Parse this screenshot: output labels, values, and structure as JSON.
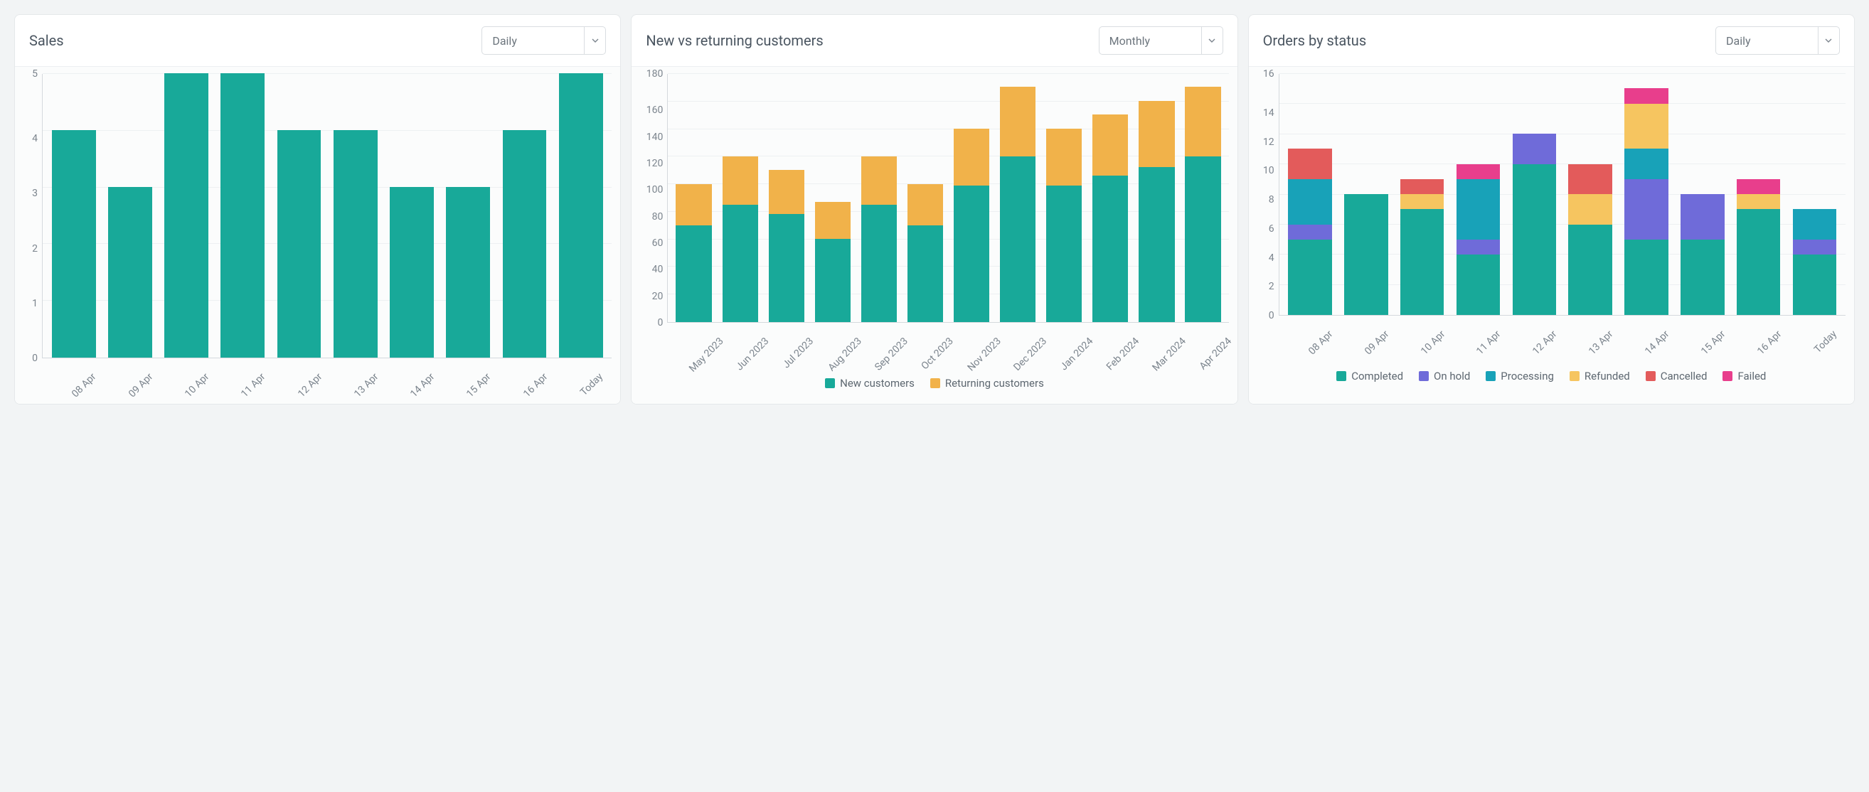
{
  "colors": {
    "teal": "#18a999",
    "orange": "#f1b24a",
    "purple": "#6f6bd9",
    "cyan": "#18a2b8",
    "amber": "#f6c560",
    "red": "#e35b5b",
    "pink": "#e83e8c"
  },
  "cards": {
    "sales": {
      "title": "Sales",
      "select": "Daily"
    },
    "customers": {
      "title": "New vs returning customers",
      "select": "Monthly"
    },
    "orders": {
      "title": "Orders by status",
      "select": "Daily"
    }
  },
  "legends": {
    "customers": {
      "new": "New customers",
      "returning": "Returning customers"
    },
    "orders": {
      "completed": "Completed",
      "onhold": "On hold",
      "processing": "Processing",
      "refunded": "Refunded",
      "cancelled": "Cancelled",
      "failed": "Failed"
    }
  },
  "chart_data": [
    {
      "id": "sales",
      "type": "bar",
      "title": "Sales",
      "xlabel": "",
      "ylabel": "",
      "ylim": [
        0,
        5
      ],
      "yticks": [
        0,
        1,
        2,
        3,
        4,
        5
      ],
      "categories": [
        "08 Apr",
        "09 Apr",
        "10 Apr",
        "11 Apr",
        "12 Apr",
        "13 Apr",
        "14 Apr",
        "15 Apr",
        "16 Apr",
        "Today"
      ],
      "values": [
        4,
        3,
        5,
        5,
        4,
        4,
        3,
        3,
        4,
        5
      ],
      "color": "#18a999"
    },
    {
      "id": "customers",
      "type": "bar-stacked",
      "title": "New vs returning customers",
      "xlabel": "",
      "ylabel": "",
      "ylim": [
        0,
        180
      ],
      "yticks": [
        0,
        20,
        40,
        60,
        80,
        100,
        120,
        140,
        160,
        180
      ],
      "categories": [
        "May 2023",
        "Jun 2023",
        "Jul 2023",
        "Aug 2023",
        "Sep 2023",
        "Oct 2023",
        "Nov 2023",
        "Dec 2023",
        "Jan 2024",
        "Feb 2024",
        "Mar 2024",
        "Apr 2024"
      ],
      "series": [
        {
          "name": "New customers",
          "color": "#18a999",
          "values": [
            70,
            85,
            78,
            60,
            85,
            70,
            99,
            120,
            99,
            106,
            112,
            120
          ]
        },
        {
          "name": "Returning customers",
          "color": "#f1b24a",
          "values": [
            30,
            35,
            32,
            27,
            35,
            30,
            41,
            50,
            41,
            44,
            48,
            50
          ]
        }
      ],
      "legend_position": "bottom"
    },
    {
      "id": "orders",
      "type": "bar-stacked",
      "title": "Orders by status",
      "xlabel": "",
      "ylabel": "",
      "ylim": [
        0,
        16
      ],
      "yticks": [
        0,
        2,
        4,
        6,
        8,
        10,
        12,
        14,
        16
      ],
      "categories": [
        "08 Apr",
        "09 Apr",
        "10 Apr",
        "11 Apr",
        "12 Apr",
        "13 Apr",
        "14 Apr",
        "15 Apr",
        "16 Apr",
        "Today"
      ],
      "series": [
        {
          "name": "Completed",
          "color": "#18a999",
          "values": [
            5,
            8,
            7,
            4,
            10,
            6,
            5,
            5,
            7,
            4
          ]
        },
        {
          "name": "On hold",
          "color": "#6f6bd9",
          "values": [
            1,
            0,
            0,
            1,
            2,
            0,
            4,
            3,
            0,
            1
          ]
        },
        {
          "name": "Processing",
          "color": "#18a2b8",
          "values": [
            3,
            0,
            0,
            4,
            0,
            0,
            2,
            0,
            0,
            2
          ]
        },
        {
          "name": "Refunded",
          "color": "#f6c560",
          "values": [
            0,
            0,
            1,
            0,
            0,
            2,
            3,
            0,
            1,
            0
          ]
        },
        {
          "name": "Cancelled",
          "color": "#e35b5b",
          "values": [
            2,
            0,
            1,
            0,
            0,
            2,
            0,
            0,
            0,
            0
          ]
        },
        {
          "name": "Failed",
          "color": "#e83e8c",
          "values": [
            0,
            0,
            0,
            1,
            0,
            0,
            1,
            0,
            1,
            0
          ]
        }
      ],
      "legend_position": "bottom"
    }
  ]
}
